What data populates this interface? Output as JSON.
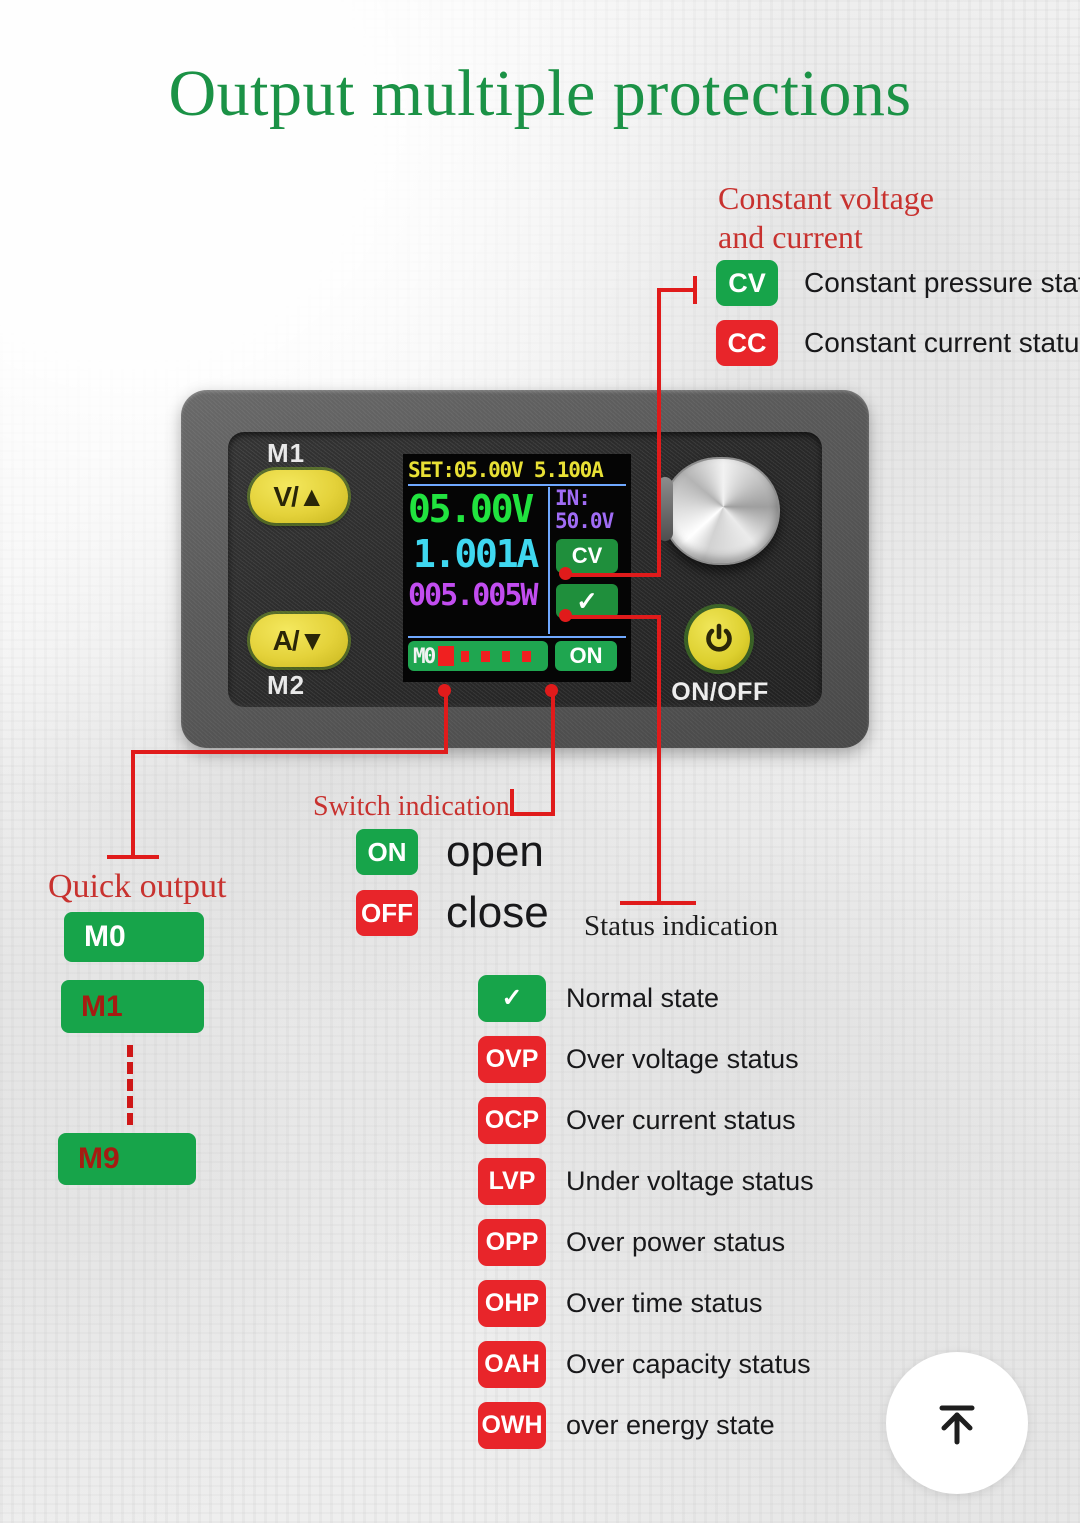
{
  "page": {
    "title": "Output multiple protections",
    "title_color": "#1b9246"
  },
  "colors": {
    "green": "#17a44a",
    "red": "#e8252a",
    "callout_red": "#e01b1b",
    "caption_red": "#c8322f"
  },
  "cv_cc": {
    "heading_line1": "Constant voltage",
    "heading_line2": "and current",
    "rows": [
      {
        "badge": "CV",
        "label": "Constant pressure status",
        "color": "#17a44a"
      },
      {
        "badge": "CC",
        "label": "Constant current status",
        "color": "#e8252a"
      }
    ]
  },
  "device": {
    "buttons": {
      "m1_label": "M1",
      "volt_button": "V/▲",
      "amp_button": "A/▼",
      "m2_label": "M2",
      "onoff_label": "ON/OFF",
      "power_icon": "power-icon"
    },
    "lcd": {
      "set_line": "SET:05.00V 5.100A",
      "voltage": "05.00V",
      "current": "1.001A",
      "power": "005.005W",
      "input_label": "IN:",
      "input_value": "50.0V",
      "cv_badge": "CV",
      "status_badge": "✓",
      "memory_slot": "M0",
      "output_badge": "ON"
    }
  },
  "quick_output": {
    "caption": "Quick output",
    "items": [
      {
        "label": "M0",
        "style": "white"
      },
      {
        "label": "M1",
        "style": "dark"
      },
      {
        "label": "M9",
        "style": "dark"
      }
    ]
  },
  "switch_indication": {
    "caption": "Switch indication",
    "rows": [
      {
        "badge": "ON",
        "label": "open",
        "color": "#17a44a"
      },
      {
        "badge": "OFF",
        "label": "close",
        "color": "#e8252a"
      }
    ]
  },
  "status_indication": {
    "caption": "Status indication",
    "rows": [
      {
        "badge": "✓",
        "label": "Normal state",
        "color": "#17a44a",
        "is_tick": true
      },
      {
        "badge": "OVP",
        "label": "Over voltage status",
        "color": "#e8252a",
        "is_tick": false
      },
      {
        "badge": "OCP",
        "label": "Over current status",
        "color": "#e8252a",
        "is_tick": false
      },
      {
        "badge": "LVP",
        "label": "Under voltage status",
        "color": "#e8252a",
        "is_tick": false
      },
      {
        "badge": "OPP",
        "label": "Over power status",
        "color": "#e8252a",
        "is_tick": false
      },
      {
        "badge": "OHP",
        "label": "Over time status",
        "color": "#e8252a",
        "is_tick": false
      },
      {
        "badge": "OAH",
        "label": "Over capacity status",
        "color": "#e8252a",
        "is_tick": false
      },
      {
        "badge": "OWH",
        "label": "over energy state",
        "color": "#e8252a",
        "is_tick": false
      }
    ]
  },
  "scroll_top": {
    "icon": "arrow-up-to-bar-icon"
  }
}
